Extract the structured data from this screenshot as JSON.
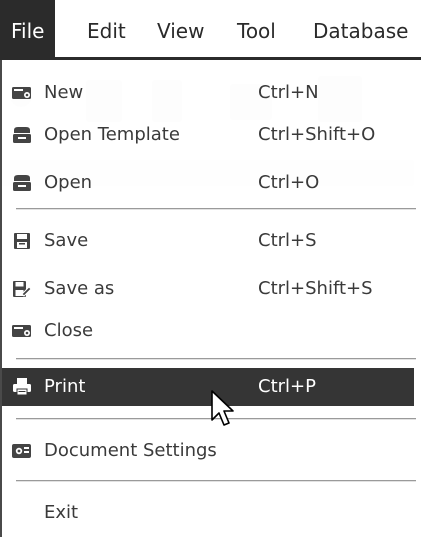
{
  "menubar": {
    "items": [
      {
        "label": "File",
        "active": true
      },
      {
        "label": "Edit"
      },
      {
        "label": "View"
      },
      {
        "label": "Tool"
      },
      {
        "label": "Database"
      }
    ]
  },
  "file_menu": {
    "items": [
      {
        "label": "New",
        "shortcut": "Ctrl+N",
        "icon": "new-document-icon"
      },
      {
        "label": "Open Template",
        "shortcut": "Ctrl+Shift+O",
        "icon": "open-template-icon"
      },
      {
        "label": "Open",
        "shortcut": "Ctrl+O",
        "icon": "open-folder-icon"
      },
      {
        "label": "Save",
        "shortcut": "Ctrl+S",
        "icon": "save-icon"
      },
      {
        "label": "Save as",
        "shortcut": "Ctrl+Shift+S",
        "icon": "save-as-icon"
      },
      {
        "label": "Close",
        "shortcut": "",
        "icon": "close-document-icon"
      },
      {
        "label": "Print",
        "shortcut": "Ctrl+P",
        "icon": "printer-icon",
        "highlighted": true
      },
      {
        "label": "Document Settings",
        "shortcut": "",
        "icon": "document-settings-icon"
      },
      {
        "label": "Exit",
        "shortcut": "",
        "icon": ""
      }
    ]
  },
  "colors": {
    "menubar_active_bg": "#2b2b2b",
    "highlight_bg": "#353535",
    "text": "#3a3a3a",
    "separator": "#9a9a9a"
  }
}
